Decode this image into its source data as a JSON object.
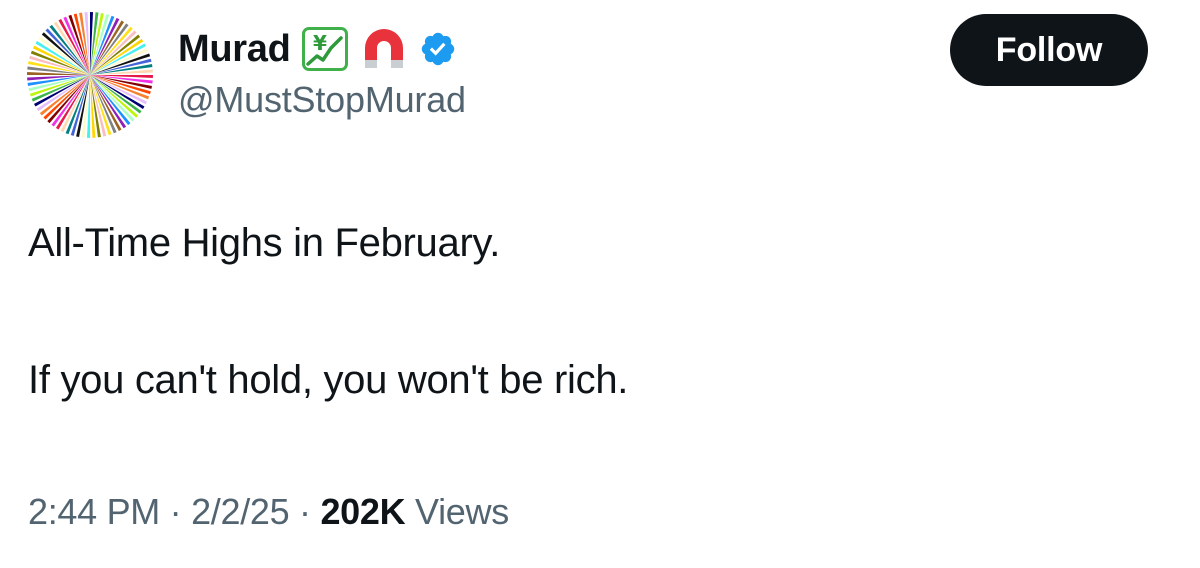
{
  "tweet": {
    "author": {
      "display_name": "Murad",
      "handle": "@MustStopMurad",
      "badges": [
        "chart-yen-icon",
        "magnet-icon",
        "verified-badge-icon"
      ],
      "verified_color": "#1d9bf0"
    },
    "follow_label": "Follow",
    "text_lines": [
      "All-Time Highs in February.",
      "If you can't hold, you won't be rich."
    ],
    "meta": {
      "time": "2:44 PM",
      "separator": " · ",
      "date": "2/2/25",
      "views_count": "202K",
      "views_label": "Views"
    }
  },
  "colors": {
    "text_primary": "#0f1419",
    "text_secondary": "#536471",
    "button_bg": "#0f1419",
    "button_text": "#ffffff"
  }
}
